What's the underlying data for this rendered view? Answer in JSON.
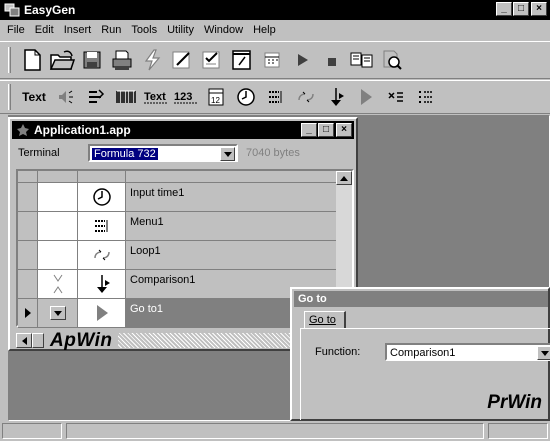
{
  "app": {
    "title": "EasyGen"
  },
  "window_controls": {
    "minimize": "_",
    "maximize": "□",
    "close": "×"
  },
  "menu": [
    "File",
    "Edit",
    "Insert",
    "Run",
    "Tools",
    "Utility",
    "Window",
    "Help"
  ],
  "toolbar1": {
    "icons": [
      "new-document-icon",
      "open-folder-icon",
      "save-icon",
      "print-icon",
      "lightning-icon",
      "edit-pencil-icon",
      "checklist-icon",
      "notepad-icon",
      "calendar-icon",
      "run-icon",
      "stop-icon",
      "compile-icon",
      "search-document-icon"
    ]
  },
  "toolbar2": {
    "text_label": "Text",
    "icons": [
      "sound-icon",
      "screen-icon",
      "barcode-icon",
      "text-entry-icon",
      "numeric-entry-icon",
      "date-icon",
      "clock-icon",
      "menu-icon",
      "loop-icon",
      "comparison-icon",
      "goto-icon",
      "delete-icon",
      "list-icon"
    ],
    "text_entry_label": "Text",
    "numeric_label": "123"
  },
  "app_window": {
    "title": "Application1.app",
    "terminal_label": "Terminal",
    "terminal_value": "Formula 732",
    "bytes": "7040 bytes",
    "rows": [
      {
        "icon": "clock-icon",
        "label": "Input time1"
      },
      {
        "icon": "menu-icon",
        "label": "Menu1"
      },
      {
        "icon": "loop-icon",
        "label": "Loop1"
      },
      {
        "icon": "comparison-icon",
        "label": "Comparison1"
      },
      {
        "icon": "goto-icon",
        "label": "Go to1"
      }
    ],
    "pane_label": "ApWin"
  },
  "goto_dialog": {
    "title": "Go to",
    "tab": "Go to",
    "function_label": "Function:",
    "function_value": "Comparison1",
    "pane_label": "PrWin"
  },
  "colors": {
    "face": "#c0c0c0",
    "title_active": "#000000",
    "title_inactive": "#808080",
    "mdi_bg": "#808080",
    "selected": "#000080"
  }
}
